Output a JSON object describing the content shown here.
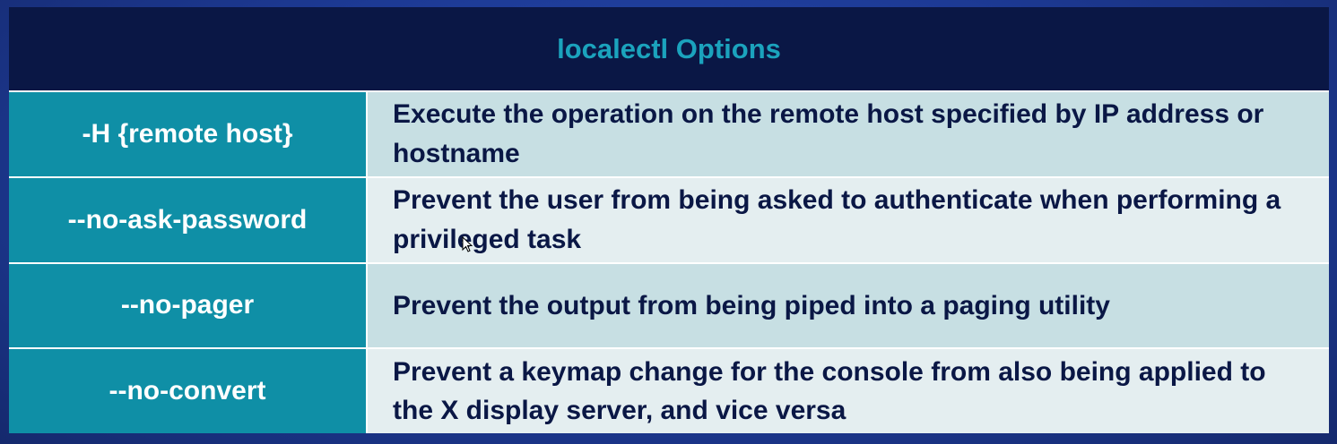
{
  "table": {
    "title": "localectl Options",
    "rows": [
      {
        "option": "-H {remote host}",
        "description": "Execute the operation on the remote host specified by IP address or hostname"
      },
      {
        "option": "--no-ask-password",
        "description": "Prevent the user from being asked to authenticate when performing a privileged task"
      },
      {
        "option": "--no-pager",
        "description": "Prevent the output from being piped into a paging utility"
      },
      {
        "option": "--no-convert",
        "description": "Prevent a keymap change for the console from also being applied to the X display server, and vice versa"
      }
    ]
  },
  "colors": {
    "header_bg": "#0a1745",
    "title_color": "#1ba3bd",
    "option_bg": "#0f8fa6",
    "desc_bg_odd": "#c7dfe3",
    "desc_bg_even": "#e4eef0",
    "desc_text": "#0a1745"
  },
  "icons": {
    "cursor": "mouse-pointer-icon"
  }
}
